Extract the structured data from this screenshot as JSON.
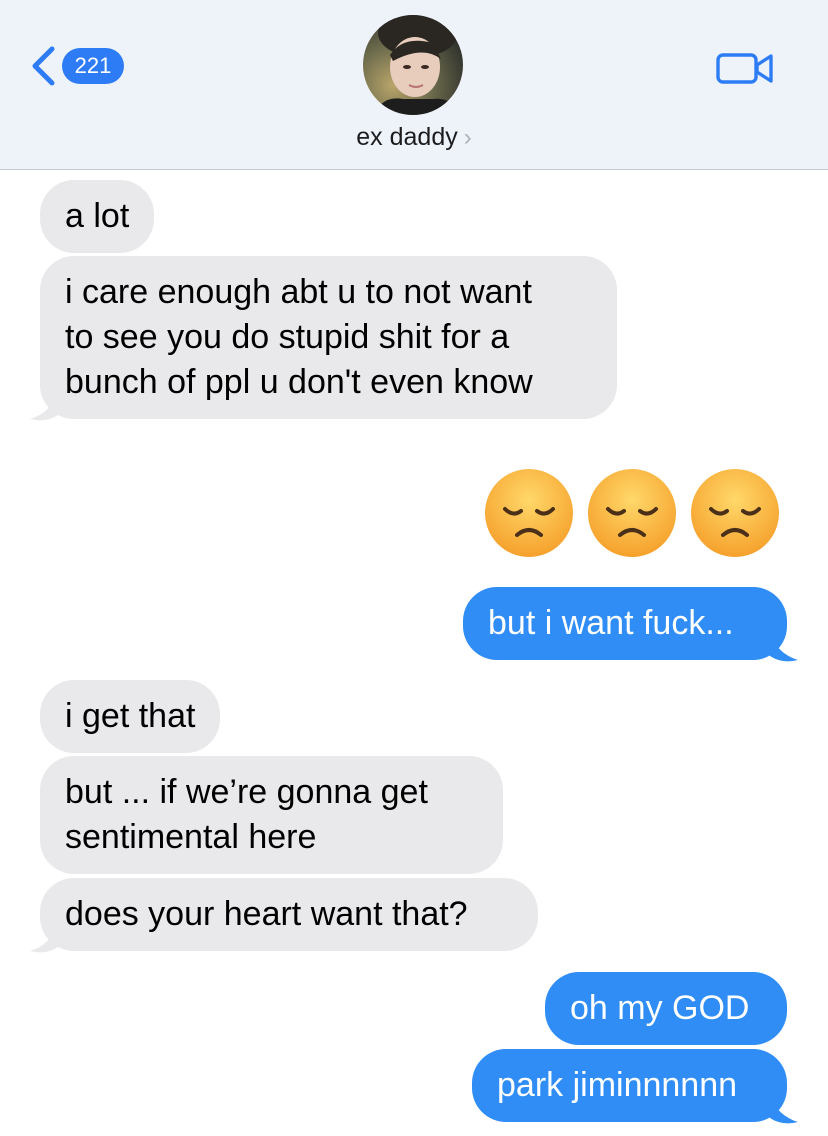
{
  "header": {
    "back_count": "221",
    "contact_name": "ex daddy",
    "back_icon": "chevron-left-icon",
    "video_icon": "video-camera-icon"
  },
  "messages": [
    {
      "from": "them",
      "text": "a lot"
    },
    {
      "from": "them",
      "lines": [
        "i care enough abt u to not want",
        "to see you do stupid shit for a",
        "bunch of ppl u don't even know"
      ]
    },
    {
      "from": "me",
      "emoji": [
        "disappointed-face",
        "disappointed-face",
        "disappointed-face"
      ]
    },
    {
      "from": "me",
      "text": "but i want fuck..."
    },
    {
      "from": "them",
      "text": "i get that"
    },
    {
      "from": "them",
      "lines": [
        "but ... if we’re gonna get",
        "sentimental here"
      ]
    },
    {
      "from": "them",
      "text": "does your heart want that?"
    },
    {
      "from": "me",
      "text": "oh my GOD"
    },
    {
      "from": "me",
      "text": "park jiminnnnnn"
    }
  ],
  "colors": {
    "incoming_bubble": "#e9e9eb",
    "outgoing_bubble": "#2f8df5",
    "accent": "#2d7cf6",
    "header_bg": "#eef3fa"
  }
}
